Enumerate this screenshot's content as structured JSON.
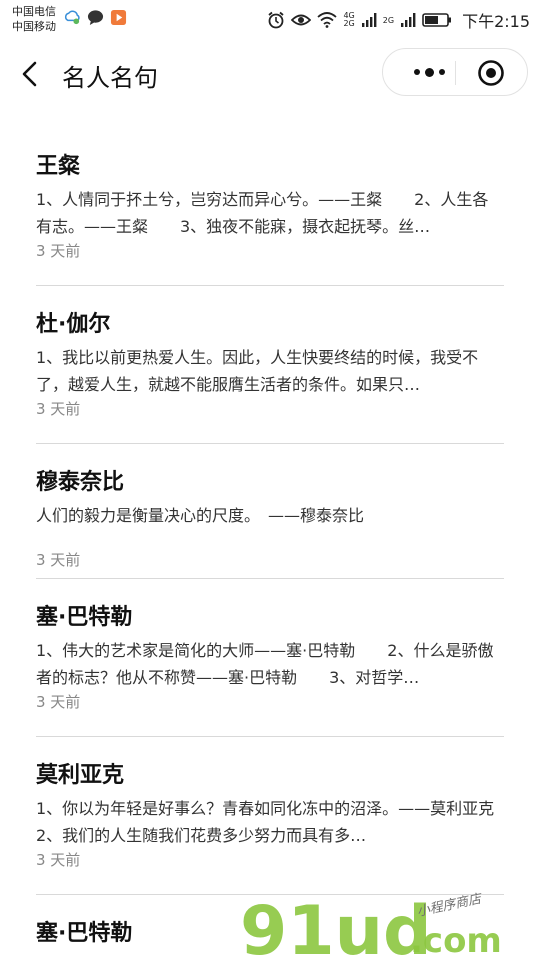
{
  "status_bar": {
    "carrier_1": "中国电信",
    "carrier_2": "中国移动",
    "network_1": "4G",
    "network_2": "2G",
    "time": "下午2:15"
  },
  "nav": {
    "title": "名人名句"
  },
  "items": [
    {
      "title": "王粲",
      "body": "1、人情同于抔土兮，岂穷达而异心兮。——王粲　　2、人生各有志。——王粲　　3、独夜不能寐，摄衣起抚琴。丝…",
      "time": "3 天前"
    },
    {
      "title": "杜·伽尔",
      "body": "1、我比以前更热爱人生。因此，人生快要终结的时候，我受不了，越爱人生，就越不能服膺生活者的条件。如果只…",
      "time": "3 天前"
    },
    {
      "title": "穆泰奈比",
      "body": "人们的毅力是衡量决心的尺度。　——穆泰奈比",
      "time": "3 天前"
    },
    {
      "title": "塞·巴特勒",
      "body": "1、伟大的艺术家是简化的大师——塞·巴特勒　　2、什么是骄傲者的标志？他从不称赞——塞·巴特勒　　3、对哲学…",
      "time": "3 天前"
    },
    {
      "title": "莫利亚克",
      "body": "1、你以为年轻是好事么？青春如同化冻中的沼泽。——莫利亚克　　2、我们的人生随我们花费多少努力而具有多…",
      "time": "3 天前"
    },
    {
      "title": "塞·巴特勒",
      "body": "",
      "time": ""
    }
  ],
  "watermark": {
    "brand": "91ud",
    "suffix": ".com",
    "tagline": "小程序商店"
  },
  "colors": {
    "watermark_green": "#8cc63f",
    "divider": "#d9d9d9",
    "time_text": "#888888"
  }
}
